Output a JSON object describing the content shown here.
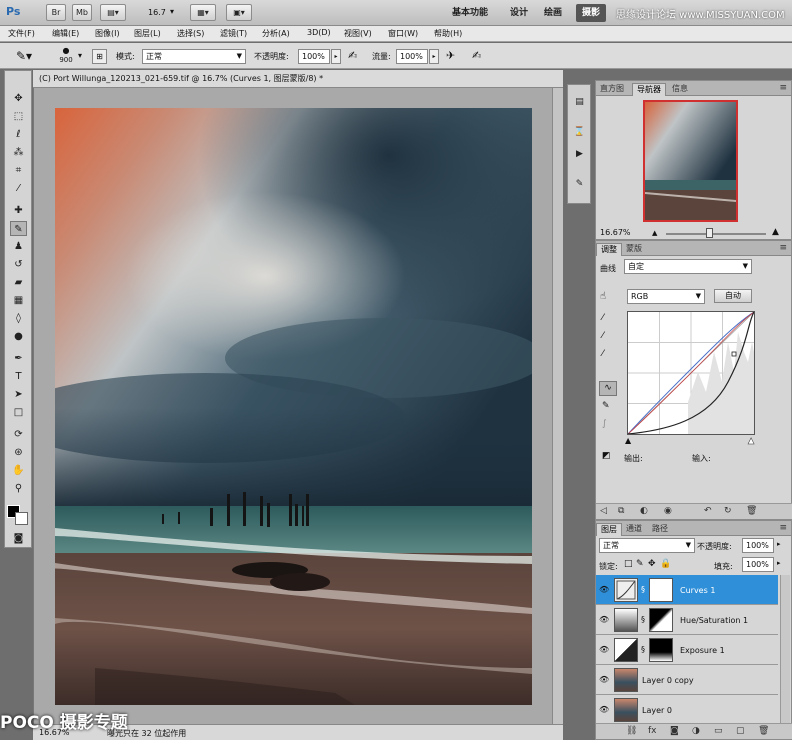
{
  "appbar": {
    "logo": "Ps",
    "buttons": [
      "Br",
      "Mb"
    ],
    "zoom": "16.7",
    "workspaces": [
      "基本功能",
      "设计",
      "绘画",
      "摄影"
    ],
    "watermark": "思缘设计论坛 www.MISSYUAN.COM"
  },
  "menu": [
    "文件(F)",
    "编辑(E)",
    "图像(I)",
    "图层(L)",
    "选择(S)",
    "滤镜(T)",
    "分析(A)",
    "3D(D)",
    "视图(V)",
    "窗口(W)",
    "帮助(H)"
  ],
  "options": {
    "brush_size": "900",
    "mode_label": "模式:",
    "mode_value": "正常",
    "opacity_label": "不透明度:",
    "opacity_value": "100%",
    "flow_label": "流量:",
    "flow_value": "100%"
  },
  "document": {
    "title": "(C) Port Willunga_120213_021-659.tif @ 16.7% (Curves 1, 图层蒙版/8) *",
    "status_zoom": "16.67%",
    "status_text": "曝光只在 32 位起作用"
  },
  "watermark_bottom": "POCO 摄影专题",
  "navigator": {
    "tabs": [
      "直方图",
      "导航器",
      "信息"
    ],
    "active_tab": "导航器",
    "zoom": "16.67%"
  },
  "adjustments": {
    "tabs": [
      "调整",
      "蒙版"
    ],
    "curves_label": "曲线",
    "preset_value": "自定",
    "channel_value": "RGB",
    "auto_label": "自动",
    "output_label": "输出:",
    "input_label": "输入:"
  },
  "layers_panel": {
    "tabs": [
      "图层",
      "通道",
      "路径"
    ],
    "blend_mode": "正常",
    "opacity_label": "不透明度:",
    "opacity_value": "100%",
    "lock_label": "锁定:",
    "fill_label": "填充:",
    "fill_value": "100%",
    "layers": [
      {
        "name": "Curves 1",
        "selected": true
      },
      {
        "name": "Hue/Saturation 1",
        "selected": false
      },
      {
        "name": "Exposure 1",
        "selected": false
      },
      {
        "name": "Layer 0 copy",
        "selected": false
      },
      {
        "name": "Layer 0",
        "selected": false
      }
    ]
  }
}
